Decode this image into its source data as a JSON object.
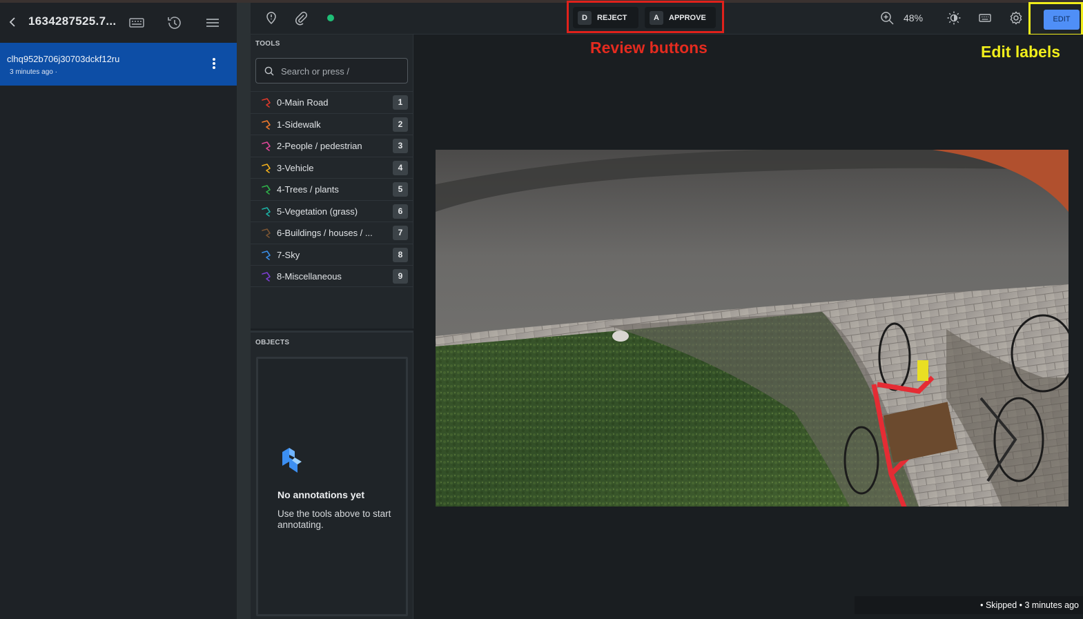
{
  "header": {
    "file_title": "1634287525.7...",
    "back_icon": "chevron-left-icon",
    "icons": [
      "keyboard-icon",
      "history-icon",
      "menu-icon"
    ]
  },
  "task": {
    "id": "clhq952b706j30703dckf12ru",
    "time": "3 minutes ago ·"
  },
  "toolbar": {
    "left_icons": [
      "issue-pin-icon",
      "attachment-icon"
    ],
    "status_color": "#1fbf77",
    "reject": {
      "key": "D",
      "label": "REJECT"
    },
    "approve": {
      "key": "A",
      "label": "APPROVE"
    },
    "zoom": "48%",
    "right_icons": [
      "zoom-in-icon",
      "brightness-icon",
      "keyboard-icon",
      "settings-icon"
    ],
    "edit_label": "EDIT"
  },
  "tools": {
    "label": "TOOLS",
    "search_placeholder": "Search or press /",
    "items": [
      {
        "name": "0-Main Road",
        "key": "1",
        "color": "#e0392b"
      },
      {
        "name": "1-Sidewalk",
        "key": "2",
        "color": "#f07a2c"
      },
      {
        "name": "2-People / pedestrian",
        "key": "3",
        "color": "#e0489a"
      },
      {
        "name": "3-Vehicle",
        "key": "4",
        "color": "#f2b01d"
      },
      {
        "name": "4-Trees / plants",
        "key": "5",
        "color": "#2fb24a"
      },
      {
        "name": "5-Vegetation (grass)",
        "key": "6",
        "color": "#1cb3a6"
      },
      {
        "name": "6-Buildings / houses / ...",
        "key": "7",
        "color": "#7a5432"
      },
      {
        "name": "7-Sky",
        "key": "8",
        "color": "#3a8ee8"
      },
      {
        "name": "8-Miscellaneous",
        "key": "9",
        "color": "#7c3fd3"
      }
    ]
  },
  "objects": {
    "label": "OBJECTS",
    "empty_title": "No annotations yet",
    "empty_text": "Use the tools above to start annotating."
  },
  "annotations": {
    "review": "Review buttons",
    "edit": "Edit labels"
  },
  "status": "• Skipped • 3 minutes ago"
}
